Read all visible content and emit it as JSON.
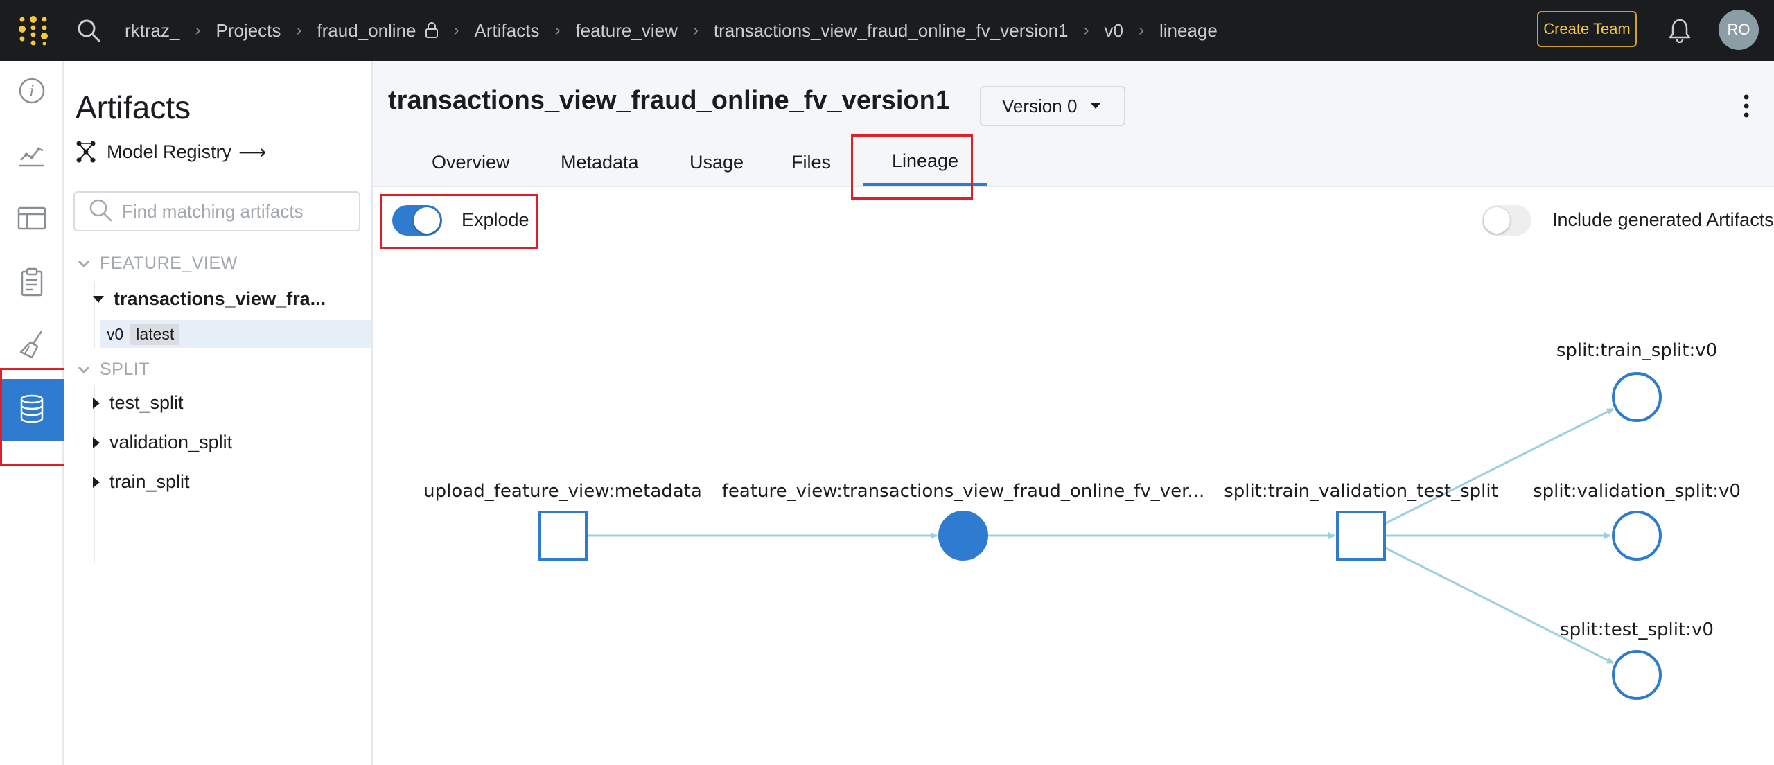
{
  "topbar": {
    "breadcrumbs": [
      "rktraz_",
      "Projects",
      "fraud_online",
      "Artifacts",
      "feature_view",
      "transactions_view_fraud_online_fv_version1",
      "v0",
      "lineage"
    ],
    "create_team_label": "Create Team",
    "avatar_initials": "RO",
    "accent_color": "#f4c843"
  },
  "rail": {
    "items": [
      "info-icon",
      "chart-icon",
      "table-icon",
      "clipboard-icon",
      "broom-icon",
      "database-icon"
    ],
    "active": "database-icon",
    "active_color": "#2e7bcf"
  },
  "sidebar": {
    "title": "Artifacts",
    "model_registry_label": "Model Registry",
    "model_registry_arrow": "⟶",
    "search_placeholder": "Find matching artifacts",
    "groups": [
      {
        "name": "FEATURE_VIEW",
        "items": [
          {
            "label": "transactions_view_fra...",
            "expanded": true,
            "versions": [
              {
                "version": "v0",
                "tag": "latest"
              }
            ]
          }
        ]
      },
      {
        "name": "SPLIT",
        "items": [
          {
            "label": "test_split",
            "expanded": false
          },
          {
            "label": "validation_split",
            "expanded": false
          },
          {
            "label": "train_split",
            "expanded": false
          }
        ]
      }
    ]
  },
  "main": {
    "title": "transactions_view_fraud_online_fv_version1",
    "version_label": "Version 0",
    "tabs": [
      "Overview",
      "Metadata",
      "Usage",
      "Files",
      "Lineage"
    ],
    "active_tab": "Lineage",
    "explode_label": "Explode",
    "explode_on": true,
    "include_generated_label": "Include generated Artifacts",
    "include_generated_on": false
  },
  "lineage": {
    "nodes": [
      {
        "label": "upload_feature_view:metadata",
        "kind": "run"
      },
      {
        "label": "feature_view:transactions_view_fraud_online_fv_ver...",
        "kind": "artifact-selected"
      },
      {
        "label": "split:train_validation_test_split",
        "kind": "run"
      },
      {
        "label": "split:train_split:v0",
        "kind": "artifact"
      },
      {
        "label": "split:validation_split:v0",
        "kind": "artifact"
      },
      {
        "label": "split:test_split:v0",
        "kind": "artifact"
      }
    ],
    "node_color": "#2e7bcf",
    "edge_color": "#9ccfe0"
  }
}
